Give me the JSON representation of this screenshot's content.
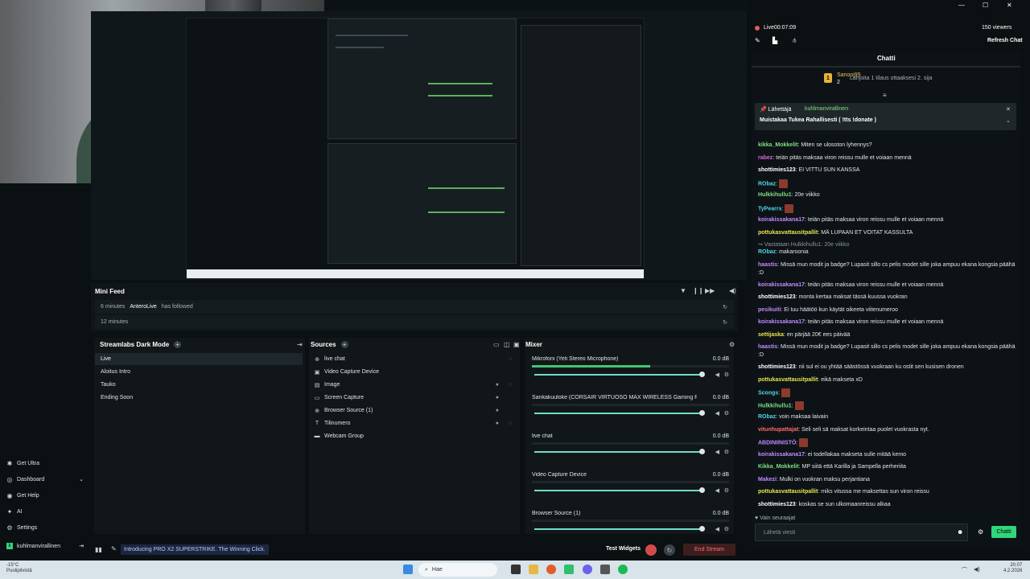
{
  "window": {
    "min": "—",
    "max": "☐",
    "close": "✕"
  },
  "stream": {
    "status": "Live",
    "duration": "00:07:09",
    "viewers": "150 viewers",
    "refresh_chat": "Refresh Chat"
  },
  "sidebar": {
    "items": [
      {
        "label": "Get Ultra",
        "icon": "ultra-icon"
      },
      {
        "label": "Dashboard",
        "icon": "dashboard-icon"
      },
      {
        "label": "Get Help",
        "icon": "help-icon"
      },
      {
        "label": "AI",
        "icon": "ai-icon"
      },
      {
        "label": "Settings",
        "icon": "settings-icon"
      }
    ],
    "user": "kuhlmanvirallinen"
  },
  "minifeed": {
    "title": "Mini Feed",
    "rows": [
      {
        "time": "6 minutes",
        "user": "AnteroLive",
        "action": "has followed"
      },
      {
        "time": "12 minutes",
        "user": "",
        "action": ""
      }
    ]
  },
  "scenes": {
    "title": "Streamlabs Dark Mode",
    "items": [
      "Live",
      "Aloitus Intro",
      "Tauko",
      "Ending Soon"
    ]
  },
  "sources": {
    "title": "Sources",
    "items": [
      {
        "label": "live chat",
        "icon": "browser-icon"
      },
      {
        "label": "Video Capture Device",
        "icon": "camera-icon"
      },
      {
        "label": "Image",
        "icon": "image-icon"
      },
      {
        "label": "Screen Capture",
        "icon": "monitor-icon"
      },
      {
        "label": "Browser Source (1)",
        "icon": "globe-icon"
      },
      {
        "label": "Tilinumero",
        "icon": "text-icon"
      },
      {
        "label": "Webcam Group",
        "icon": "folder-icon"
      }
    ]
  },
  "mixer": {
    "title": "Mixer",
    "items": [
      {
        "name": "Mikrofoni (Yeti Stereo Microphone)",
        "db": "0.0 dB",
        "level": 0.6
      },
      {
        "name": "Sankakuuloke (CORSAIR VIRTUOSO MAX WIRELESS Gaming Recei...",
        "db": "0.0 dB",
        "level": 0
      },
      {
        "name": "live chat",
        "db": "0.0 dB",
        "level": 0
      },
      {
        "name": "Video Capture Device",
        "db": "0.0 dB",
        "level": 0
      },
      {
        "name": "Browser Source (1)",
        "db": "0.0 dB",
        "level": 0
      }
    ]
  },
  "statusbar": {
    "promo": "Introducing PRO X2 SUPERSTRIKE. The Winning Click.",
    "test_widgets": "Test Widgets",
    "end_stream": "End Stream"
  },
  "chat": {
    "title": "Chatti",
    "gift": {
      "user": "Sanooj95",
      "count": "2",
      "text": "Lahjoita 1 tilaus ottaaksesi 2. sija"
    },
    "pinned": {
      "from_label": "Lähettäjä",
      "user": "kuhlmanvirallinen",
      "message": "Muistakaa Tukea Rahallisesti ( !tts !donate )"
    },
    "messages": [
      {
        "user": "kikka_Mokkelit",
        "text": "Miten se ulosoton lyhennys?",
        "color": "#7fe07f"
      },
      {
        "user": "rabez",
        "text": "teiän pitäs maksaa viron reissu mulle et voiaan mennä",
        "color": "#d46bd4"
      },
      {
        "user": "shottimies123",
        "text": "EI VITTU SUN KANSSA",
        "color": "#fff"
      },
      {
        "user": "RObaz",
        "text": "",
        "color": "#4fd6e6"
      },
      {
        "user": "Hulkkihullu1",
        "text": "20e viikko",
        "color": "#7fe07f"
      },
      {
        "user": "TyPearrs",
        "text": "",
        "color": "#4fd6e6"
      },
      {
        "user": "koirakissakana17",
        "text": "teiän pitäs maksaa viron reissu mulle et voiaan mennä",
        "color": "#c08bff"
      },
      {
        "user": "pottukasvattausitpallit",
        "text": "MÄ LUPAAN ET VOITAT KASSULTA",
        "color": "#e6e64f"
      },
      {
        "user": "RObaz",
        "text": "makaroonia",
        "color": "#4fd6e6"
      },
      {
        "user": "haastis",
        "text": "Missä mun modit ja badge? Lupasit sillo cs pelis modet sille joka ampuu ekana kongsia päähä :D",
        "color": "#c08bff"
      },
      {
        "user": "koirakissakana17",
        "text": "teiän pitäs maksaa viron reissu mulle et voiaan mennä",
        "color": "#c08bff"
      },
      {
        "user": "shottimies123",
        "text": "monta kertaa maksat tässä kuussa vuokran",
        "color": "#fff"
      },
      {
        "user": "pesikuiti",
        "text": "Ei tuu häätöö kun käytät oikeeta viitenumeroo",
        "color": "#c08bff"
      },
      {
        "user": "koirakissakana17",
        "text": "teiän pitäs maksaa viron reissu mulle et voiaan mennä",
        "color": "#c08bff"
      },
      {
        "user": "settijaska",
        "text": "en pärjää 20€ ees päivää",
        "color": "#e6e64f"
      },
      {
        "user": "haastis",
        "text": "Missä mun modit ja badge? Lupasit sillo cs pelis modet sille joka ampuu ekana kongsia päähä :D",
        "color": "#c08bff"
      },
      {
        "user": "shottimies123",
        "text": "nii sul ei ou yhtää säästössä vuokraan ku ostit sen kusisen dronen",
        "color": "#fff"
      },
      {
        "user": "pottukasvattausitpallit",
        "text": "eikä makseta xD",
        "color": "#e6e64f"
      },
      {
        "user": "Scongs",
        "text": "",
        "color": "#4fd6e6"
      },
      {
        "user": "Hulkkihullu1",
        "text": "",
        "color": "#7fe07f"
      },
      {
        "user": "RObaz",
        "text": "voin maksaa laivain",
        "color": "#4fd6e6"
      },
      {
        "user": "vitunhupattajat",
        "text": "Seli seli sä maksat korkeintaa puolet vuokrasta nyt.",
        "color": "#ff6b6b"
      },
      {
        "user": "ABDINIINISTÖ",
        "text": "",
        "color": "#c08bff"
      },
      {
        "user": "koirakissakana17",
        "text": "ei todellakaa makseta sulle mitää kemo",
        "color": "#c08bff"
      },
      {
        "user": "Kikka_Mokkelit",
        "text": "MP siitä että Karilla ja Sampella perheriita",
        "color": "#7fe07f"
      },
      {
        "user": "Makezi",
        "text": "Mulki on vuokran maksu perjantiana",
        "color": "#c08bff"
      },
      {
        "user": "pottukasvattausitpallit",
        "text": "miks vitussa me maksettas sun viron reissu",
        "color": "#e6e64f"
      },
      {
        "user": "shottimies123",
        "text": "koskas se sun ulkomaanreissu alkaa",
        "color": "#fff"
      }
    ],
    "reply_hint": "↪ Vastataan Hulkkihullu1: 20e viikko",
    "followers_only": "Vain seuraajat",
    "input_placeholder": "Lähetä viesti",
    "send": "Chatti"
  },
  "taskbar": {
    "weather_temp": "-15°C",
    "weather_text": "Puolipilvistä",
    "search": "Hae",
    "time": "20.07",
    "date": "4.2.2026"
  }
}
